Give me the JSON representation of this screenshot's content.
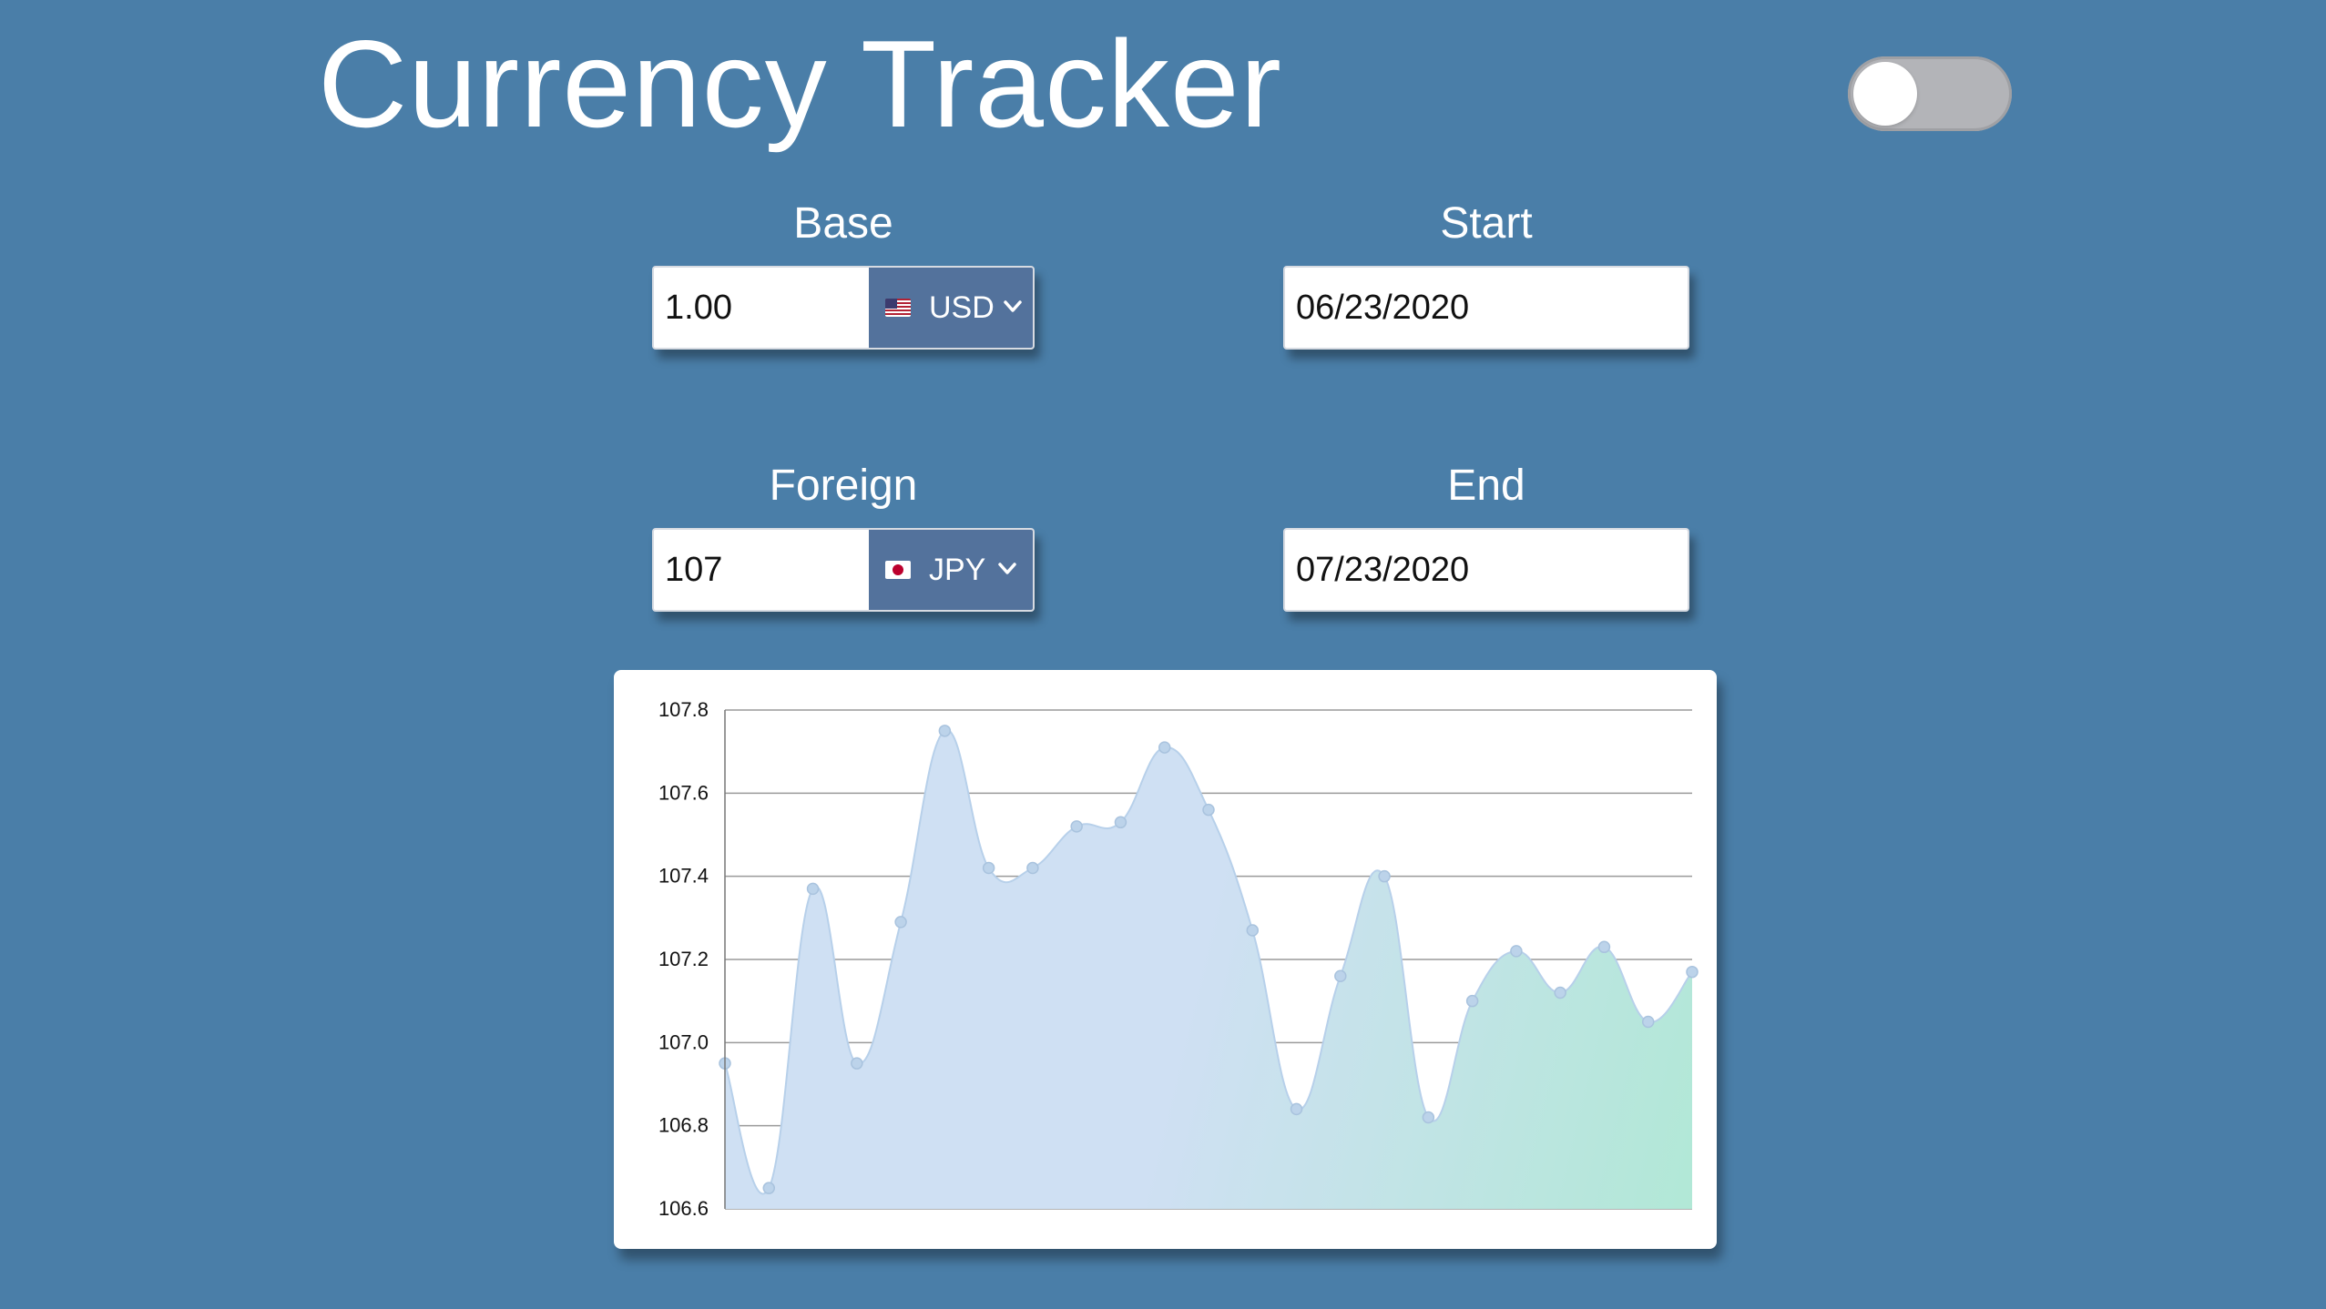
{
  "header": {
    "title": "Currency Tracker"
  },
  "theme_toggle": {
    "on": false
  },
  "base": {
    "label": "Base",
    "amount": "1.00",
    "currency": "USD",
    "flag": "us-flag-icon"
  },
  "foreign": {
    "label": "Foreign",
    "amount": "107",
    "currency": "JPY",
    "flag": "jp-flag-icon"
  },
  "start": {
    "label": "Start",
    "date": "06/23/2020"
  },
  "end": {
    "label": "End",
    "date": "07/23/2020"
  },
  "colors": {
    "background": "#4a7ea8",
    "select_bg": "#53729c",
    "area_start": "#cfe0f3",
    "area_end": "#b1e8d6",
    "line": "#b7d0ea",
    "point": "#bcd3ea"
  },
  "chart_data": {
    "type": "area",
    "title": "",
    "xlabel": "",
    "ylabel": "",
    "ylim": [
      106.6,
      107.8
    ],
    "yticks": [
      "107.8",
      "107.6",
      "107.4",
      "107.2",
      "107.0",
      "106.8",
      "106.6"
    ],
    "grid": true,
    "legend": "none",
    "series": [
      {
        "values": [
          106.95,
          106.65,
          107.37,
          106.95,
          107.29,
          107.75,
          107.42,
          107.42,
          107.52,
          107.53,
          107.71,
          107.56,
          107.27,
          106.84,
          107.16,
          107.4,
          106.82,
          107.1,
          107.22,
          107.12,
          107.23,
          107.05,
          107.17
        ]
      }
    ]
  }
}
